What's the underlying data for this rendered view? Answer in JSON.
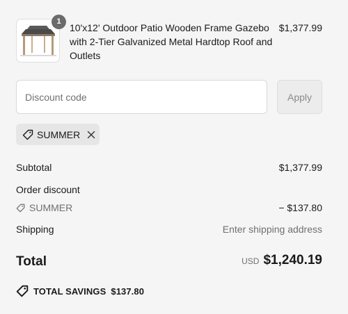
{
  "product": {
    "quantity": "1",
    "title": "10'x12' Outdoor Patio Wooden Frame Gazebo with 2-Tier Galvanized Metal Hardtop Roof and Outlets",
    "price": "$1,377.99",
    "image_icon": "gazebo-image"
  },
  "discount": {
    "placeholder": "Discount code",
    "value": "",
    "apply_label": "Apply",
    "applied_code": "SUMMER"
  },
  "totals": {
    "subtotal_label": "Subtotal",
    "subtotal_value": "$1,377.99",
    "order_discount_label": "Order discount",
    "discount_code": "SUMMER",
    "discount_value": "− $137.80",
    "shipping_label": "Shipping",
    "shipping_value": "Enter shipping address",
    "total_label": "Total",
    "currency": "USD",
    "total_value": "$1,240.19",
    "savings_label": "TOTAL SAVINGS",
    "savings_value": "$137.80"
  },
  "colors": {
    "background": "#f5f5f5",
    "text": "#1a1a1a",
    "muted": "#707070",
    "chip": "#e6e6e6"
  }
}
